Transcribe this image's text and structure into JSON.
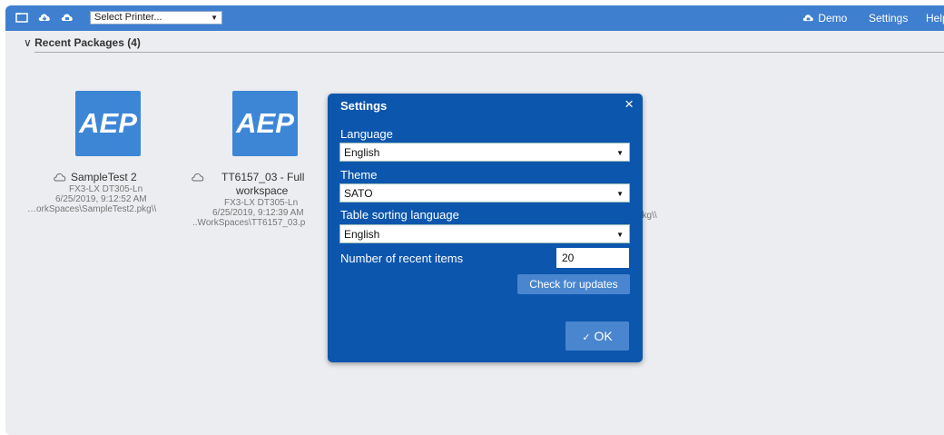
{
  "toolbar": {
    "printer_placeholder": "Select Printer...",
    "demo_label": "Demo",
    "settings_label": "Settings",
    "help_label": "Help"
  },
  "section": {
    "title": "Recent Packages",
    "count": "(4)"
  },
  "packages": [
    {
      "tile": "AEP",
      "name": "SampleTest 2",
      "printer": "FX3-LX DT305-Ln",
      "date": "6/25/2019, 9:12:52 AM",
      "path": "…orkSpaces\\SampleTest2.pkg\\\\"
    },
    {
      "tile": "AEP",
      "name_line1": "TT6157_03 - Full",
      "name_line2": "workspace",
      "printer": "FX3-LX DT305-Ln",
      "date": "6/25/2019, 9:12:39 AM",
      "path": "..WorkSpaces\\TT6157_03.p"
    },
    {
      "path_fragment": "pkg\\\\"
    }
  ],
  "dialog": {
    "title": "Settings",
    "close": "×",
    "language_label": "Language",
    "language_value": "English",
    "theme_label": "Theme",
    "theme_value": "SATO",
    "sorting_label": "Table sorting language",
    "sorting_value": "English",
    "recent_label": "Number of recent items",
    "recent_value": "20",
    "check_updates": "Check for updates",
    "ok_label": "OK",
    "ok_check": "✓"
  }
}
